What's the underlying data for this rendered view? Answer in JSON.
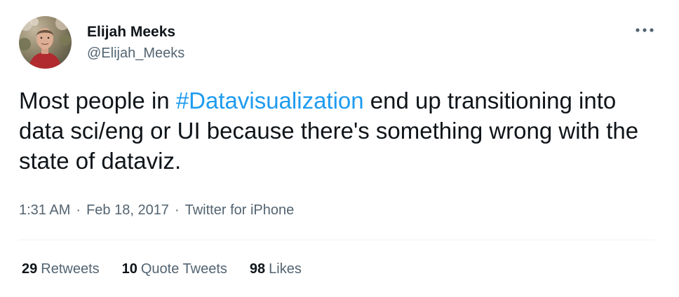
{
  "user": {
    "display_name": "Elijah Meeks",
    "handle": "@Elijah_Meeks",
    "avatar_alt": "profile photo"
  },
  "tweet": {
    "text_before": "Most people in ",
    "hashtag": "#Datavisualization",
    "text_after": " end up transitioning into data sci/eng or UI because there's something wrong with the state of dataviz."
  },
  "meta": {
    "time": "1:31 AM",
    "separator": "·",
    "date": "Feb 18, 2017",
    "source": "Twitter for iPhone"
  },
  "stats": [
    {
      "count": "29",
      "label": "Retweets"
    },
    {
      "count": "10",
      "label": "Quote Tweets"
    },
    {
      "count": "98",
      "label": "Likes"
    }
  ],
  "icons": {
    "more": "more-horizontal-icon"
  },
  "colors": {
    "text_primary": "#0f1419",
    "text_secondary": "#536471",
    "accent": "#1d9bf0",
    "divider": "#eff3f4"
  }
}
